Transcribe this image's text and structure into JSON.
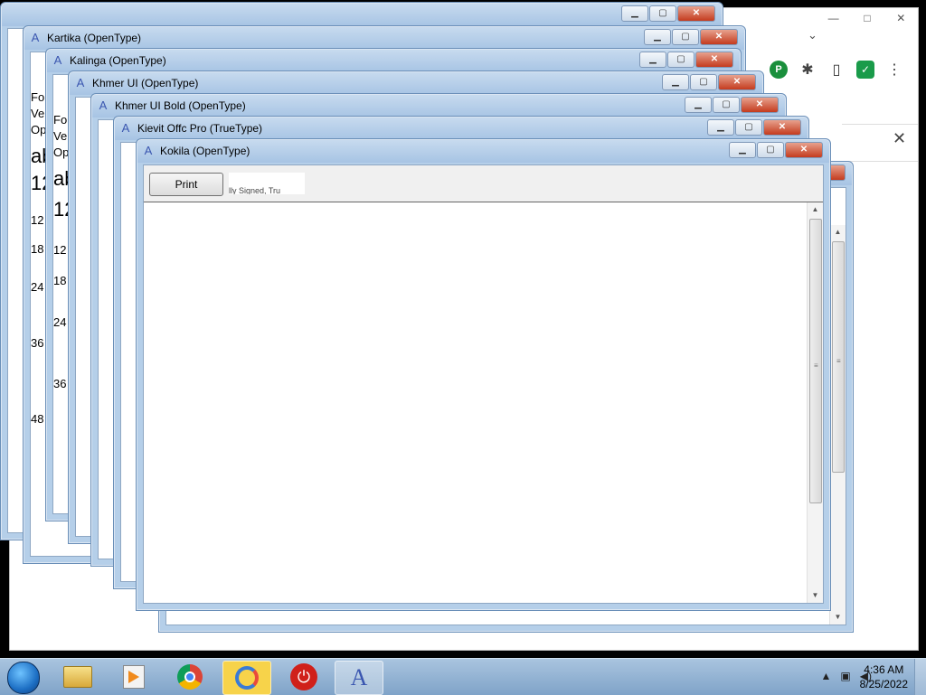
{
  "browser": {
    "ctl_min": "—",
    "ctl_max": "□",
    "ctl_close": "✕",
    "chevron": "⌄",
    "close_bar": "✕",
    "extension_icons": [
      "P",
      "✱",
      "▯",
      "✓",
      "⋮"
    ]
  },
  "windows": [
    {
      "title": "Kartika (OpenType)",
      "lines": [
        "For",
        "Ver",
        "Op"
      ],
      "samples": [
        "ab",
        "12"
      ],
      "sizes": [
        "12",
        "18",
        "24",
        "36",
        "48"
      ]
    },
    {
      "title": "Kalinga (OpenType)",
      "lines": [
        "For",
        "Ver",
        "Op"
      ],
      "samples": [
        "ab",
        "12"
      ],
      "sizes": [
        "12",
        "18",
        "24",
        "36"
      ]
    },
    {
      "title": "Khmer UI (OpenType)"
    },
    {
      "title": "Khmer UI Bold (OpenType)"
    },
    {
      "title": "Kievit Offc Pro (TrueType)"
    },
    {
      "title": "Kokila (OpenType)",
      "print_label": "Print",
      "signature_text": "lly Signed, Tru"
    }
  ],
  "window_controls": {
    "min": "▁",
    "max": "▢",
    "close": "✕"
  },
  "taskbar": {
    "apps": [
      "explorer-icon",
      "media-player-icon",
      "chrome-icon",
      "vpn-icon",
      "power-icon",
      "font-viewer-icon"
    ],
    "tray_up": "▲",
    "tray_icons": [
      "network-icon",
      "volume-icon"
    ],
    "time": "4:36 AM",
    "date": "8/25/2022"
  }
}
